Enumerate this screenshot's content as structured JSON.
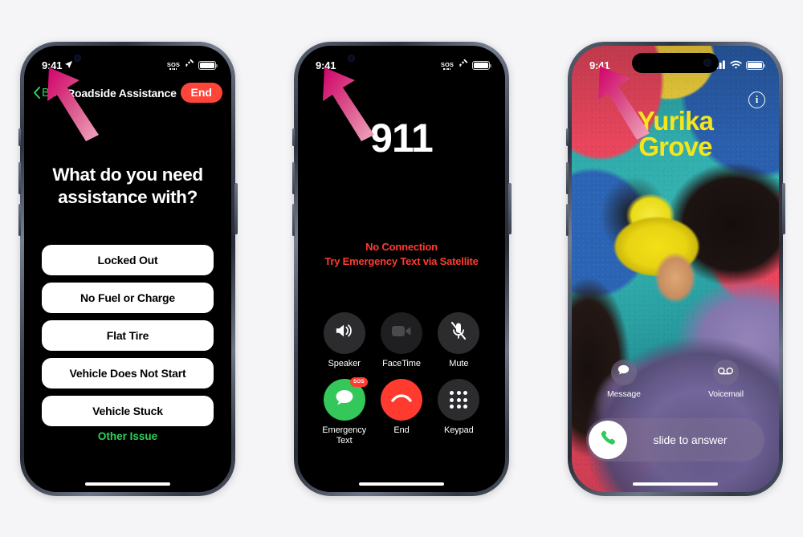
{
  "background_color": "#f5f5f7",
  "accent_colors": {
    "green": "#30d158",
    "red": "#ff453a",
    "call_red": "#ff3b30",
    "call_green": "#34c759",
    "caller_name_yellow": "#f5e51e",
    "arrow_pink": "#d63384"
  },
  "phones": [
    {
      "id": "roadside-assistance",
      "status_bar": {
        "time": "9:41",
        "location_icon": "location-arrow-icon",
        "icons": [
          "sos-icon",
          "satellite-icon",
          "battery-icon"
        ],
        "sos_label": "SOS"
      },
      "navbar": {
        "back_label": "Back",
        "title": "Roadside Assistance",
        "end_label": "End"
      },
      "heading": "What do you need assistance with?",
      "options": [
        "Locked Out",
        "No Fuel or Charge",
        "Flat Tire",
        "Vehicle Does Not Start",
        "Vehicle Stuck"
      ],
      "footer_link": "Other Issue"
    },
    {
      "id": "emergency-call",
      "status_bar": {
        "time": "9:41",
        "icons": [
          "sos-icon",
          "satellite-icon",
          "battery-icon"
        ],
        "sos_label": "SOS"
      },
      "call_number": "911",
      "call_status_line1": "No Connection",
      "call_status_line2": "Try Emergency Text via Satellite",
      "controls": [
        {
          "label": "Speaker",
          "icon": "speaker-icon",
          "style": "dark"
        },
        {
          "label": "FaceTime",
          "icon": "facetime-video-icon",
          "style": "disabled"
        },
        {
          "label": "Mute",
          "icon": "mic-muted-icon",
          "style": "dark"
        },
        {
          "label": "Emergency Text",
          "icon": "message-bubble-icon",
          "style": "green",
          "badge": "SOS"
        },
        {
          "label": "End",
          "icon": "end-call-icon",
          "style": "red"
        },
        {
          "label": "Keypad",
          "icon": "keypad-icon",
          "style": "dark"
        }
      ]
    },
    {
      "id": "incoming-call",
      "status_bar": {
        "time": "9:41",
        "icons": [
          "cellular-icon",
          "wifi-icon",
          "battery-icon"
        ]
      },
      "caller_first_name": "Yurika",
      "caller_last_name": "Grove",
      "info_icon": "info-circle-icon",
      "actions": [
        {
          "label": "Message",
          "icon": "message-bubble-icon"
        },
        {
          "label": "Voicemail",
          "icon": "voicemail-icon"
        }
      ],
      "slider_label": "slide to answer",
      "slider_icon": "phone-handset-icon"
    }
  ],
  "annotations": [
    {
      "name": "pointer-arrow-1",
      "target": "status-bar-time-phone-1"
    },
    {
      "name": "pointer-arrow-2",
      "target": "status-bar-time-phone-2"
    },
    {
      "name": "pointer-arrow-3",
      "target": "status-bar-time-phone-3"
    }
  ]
}
